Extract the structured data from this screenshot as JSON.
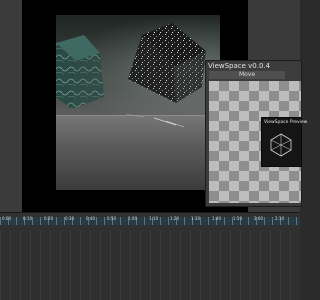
{
  "viewspace": {
    "title": "ViewSpace v0.0.4",
    "move_label": "Move",
    "preview_title": "ViewSpace Preview"
  },
  "timeline": {
    "ruler_labels": [
      "0:00",
      "0:10",
      "0:20",
      "0:30",
      "0:40",
      "0:50",
      "1:00",
      "1:10",
      "1:20",
      "1:30",
      "1:40",
      "1:50",
      "2:00",
      "2:10"
    ]
  },
  "colors": {
    "timeline_band": "#2a3a44",
    "canvas_bg": "#000000"
  }
}
